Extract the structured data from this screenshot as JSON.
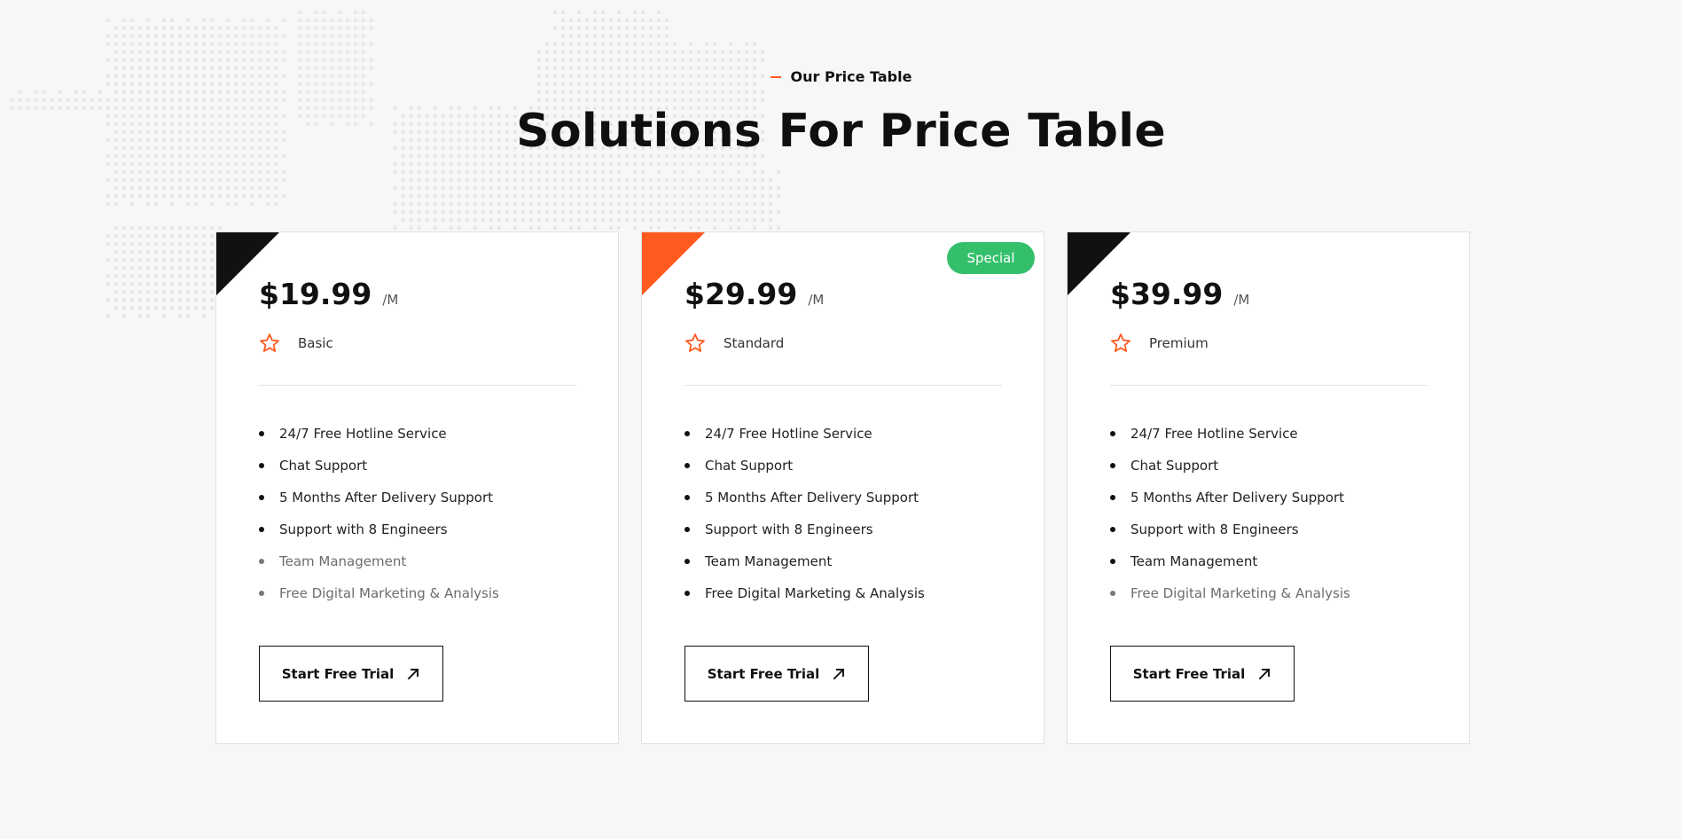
{
  "colors": {
    "accent": "#ff5a1f",
    "badge": "#34c06b",
    "dark": "#111111"
  },
  "section": {
    "kicker": "Our Price Table",
    "title": "Solutions For Price Table"
  },
  "plans": [
    {
      "price": "$19.99",
      "period": "/M",
      "name": "Basic",
      "corner": "dark",
      "badge": null,
      "features": [
        {
          "text": "24/7 Free Hotline Service",
          "included": true
        },
        {
          "text": "Chat Support",
          "included": true
        },
        {
          "text": "5 Months After Delivery Support",
          "included": true
        },
        {
          "text": "Support with 8 Engineers",
          "included": true
        },
        {
          "text": "Team Management",
          "included": false
        },
        {
          "text": "Free Digital Marketing & Analysis",
          "included": false
        }
      ],
      "cta": "Start Free Trial",
      "cta_icon": "arrow-up-right-icon",
      "plan_icon": "star-icon"
    },
    {
      "price": "$29.99",
      "period": "/M",
      "name": "Standard",
      "corner": "accent",
      "badge": "Special",
      "features": [
        {
          "text": "24/7 Free Hotline Service",
          "included": true
        },
        {
          "text": "Chat Support",
          "included": true
        },
        {
          "text": "5 Months After Delivery Support",
          "included": true
        },
        {
          "text": "Support with 8 Engineers",
          "included": true
        },
        {
          "text": "Team Management",
          "included": true
        },
        {
          "text": "Free Digital Marketing & Analysis",
          "included": true
        }
      ],
      "cta": "Start Free Trial",
      "cta_icon": "arrow-up-right-icon",
      "plan_icon": "star-icon"
    },
    {
      "price": "$39.99",
      "period": "/M",
      "name": "Premium",
      "corner": "dark",
      "badge": null,
      "features": [
        {
          "text": "24/7 Free Hotline Service",
          "included": true
        },
        {
          "text": "Chat Support",
          "included": true
        },
        {
          "text": "5 Months After Delivery Support",
          "included": true
        },
        {
          "text": "Support with 8 Engineers",
          "included": true
        },
        {
          "text": "Team Management",
          "included": true
        },
        {
          "text": "Free Digital Marketing & Analysis",
          "included": false
        }
      ],
      "cta": "Start Free Trial",
      "cta_icon": "arrow-up-right-icon",
      "plan_icon": "star-icon"
    }
  ]
}
